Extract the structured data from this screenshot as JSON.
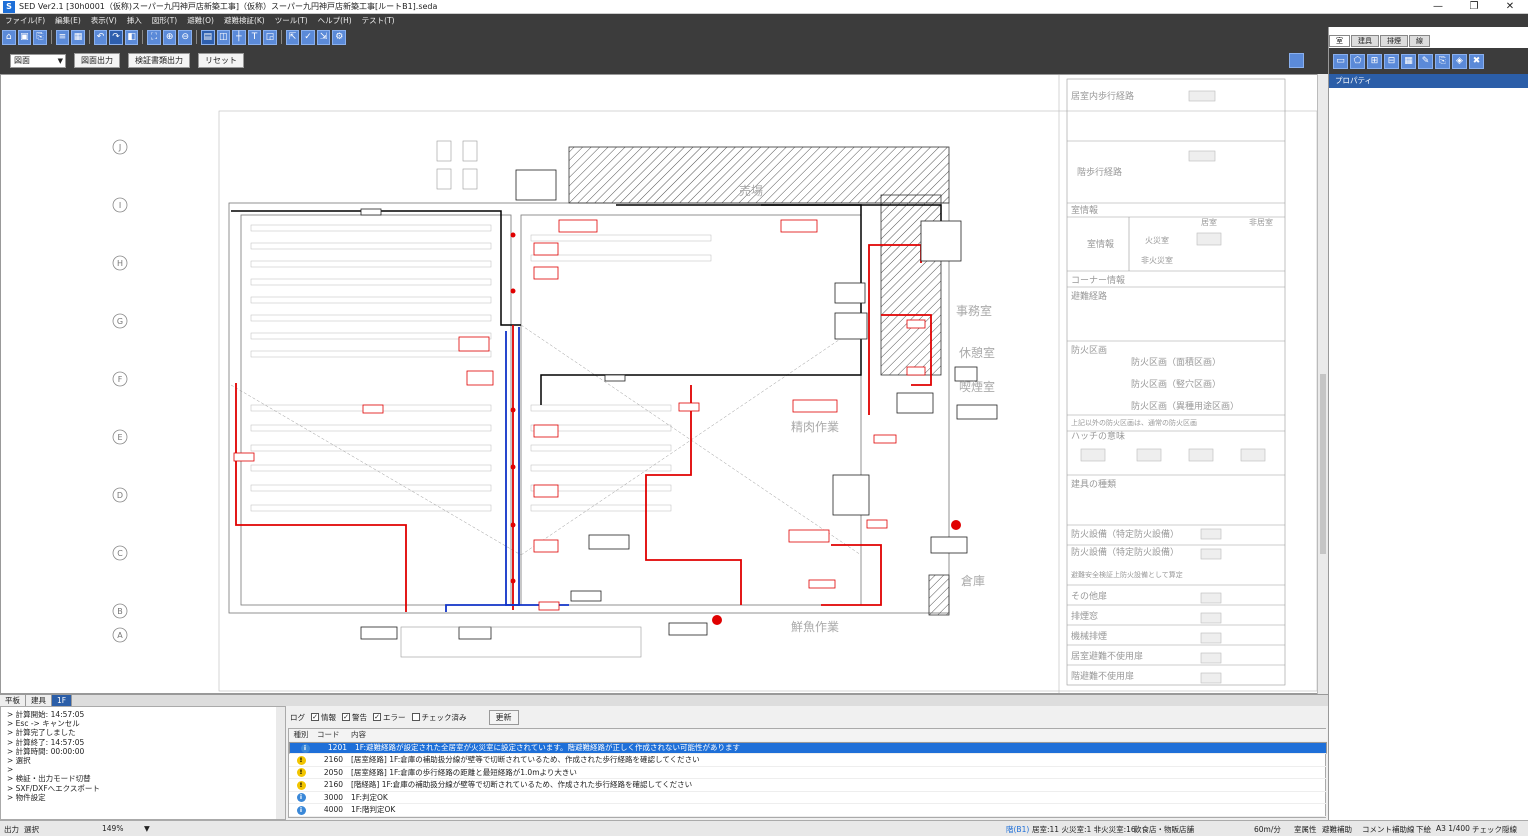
{
  "window": {
    "app_logo": "S",
    "title": "SED Ver2.1 [30h0001（仮称)スーパー九円神戸店新築工事]（仮称）スーパー九円神戸店新築工事[ルートB1].seda",
    "controls": [
      "—",
      "❐",
      "✕"
    ]
  },
  "menu": [
    "ファイル(F)",
    "編集(E)",
    "表示(V)",
    "挿入",
    "図形(T)",
    "避難(O)",
    "避難検証(K)",
    "ツール(T)",
    "ヘルプ(H)",
    "テスト(T)"
  ],
  "toolbar2": {
    "view_select": "図面",
    "drawing_output_label": "図面出力",
    "verify_output_label": "検証書類出力",
    "reset_label": "リセット"
  },
  "right_panel": {
    "tabs": [
      "室",
      "建具",
      "排煙",
      "線"
    ],
    "property_header": "プロパティ"
  },
  "drawing": {
    "axis_labels": [
      "J",
      "I",
      "H",
      "G",
      "F",
      "E",
      "D",
      "C",
      "B",
      "A"
    ],
    "room_labels": [
      "事務室",
      "休憩室",
      "喫煙室",
      "精肉作業",
      "鮮魚作業",
      "売場",
      "倉庫"
    ],
    "legend": {
      "rows": [
        "居室内歩行経路",
        "階歩行経路",
        "室情報",
        "室情報",
        "コーナー情報",
        "避難経路",
        "防火区画",
        "防火区画（面積区画）",
        "防火区画（竪穴区画）",
        "防火区画（異種用途区画）",
        "上記以外の防火区画は、通常の防火区画",
        "ハッチの意味",
        "建具の種類",
        "防火設備（特定防火設備）",
        "防火設備（特定防火設備）",
        "避難安全検証上防火設備として算定",
        "その他扉",
        "排煙窓",
        "機械排煙",
        "居室避難不使用扉",
        "階避難不使用扉"
      ],
      "cols": [
        "居室",
        "非居室",
        "火災室",
        "非火災室"
      ]
    }
  },
  "bottom_tabs": [
    "平板",
    "建具",
    "1F"
  ],
  "console": {
    "lines": [
      "> 計算開始: 14:57:05",
      "> Esc -> キャンセル",
      "> 計算完了しました",
      "> 計算終了: 14:57:05",
      "> 計算時間: 00:00:00",
      "> 選択",
      ">",
      "> 検証・出力モード切替",
      "> SXF/DXFへエクスポート",
      "> 物件設定"
    ]
  },
  "log": {
    "filter_label": "ログ",
    "filters": [
      {
        "label": "情報",
        "checked": true
      },
      {
        "label": "警告",
        "checked": true
      },
      {
        "label": "エラー",
        "checked": true
      },
      {
        "label": "チェック済み",
        "checked": false
      }
    ],
    "refresh_label": "更新",
    "headers": [
      "種別",
      "コード",
      "内容"
    ],
    "rows": [
      {
        "type": "info",
        "code": "1201",
        "message": "1F:避難経路が設定された全居室が火災室に設定されています。階避難経路が正しく作成されない可能性があります"
      },
      {
        "type": "warn",
        "code": "2160",
        "message": "[居室経路] 1F:倉庫の補助扱分線が壁等で切断されているため、作成された歩行経路を確認してください"
      },
      {
        "type": "warn",
        "code": "2050",
        "message": "[居室経路] 1F:倉庫の歩行経路の距離と最短経路が1.0mより大きい"
      },
      {
        "type": "warn",
        "code": "2160",
        "message": "[階経路] 1F:倉庫の補助扱分線が壁等で切断されているため、作成された歩行経路を確認してください"
      },
      {
        "type": "info",
        "code": "3000",
        "message": "1F:判定OK"
      },
      {
        "type": "info",
        "code": "4000",
        "message": "1F:階判定OK"
      }
    ]
  },
  "statusbar": {
    "left": "出力",
    "mode": "選択",
    "zoom": "149%",
    "floor": "階(B1)",
    "room_count": "居室:11 火災室:1 非火災室:16",
    "category": "飲食店・物販店舗",
    "speed": "60m/分",
    "tools": [
      "室属性",
      "避難補助",
      "コメント",
      "補助線",
      "下絵",
      "A3 1/400",
      "チェック",
      "隠線"
    ]
  },
  "colors": {
    "accent": "#1e6fd8",
    "route_red": "#e00000",
    "route_blue": "#1033c8",
    "toolbar_bg": "#3c3c3c"
  }
}
